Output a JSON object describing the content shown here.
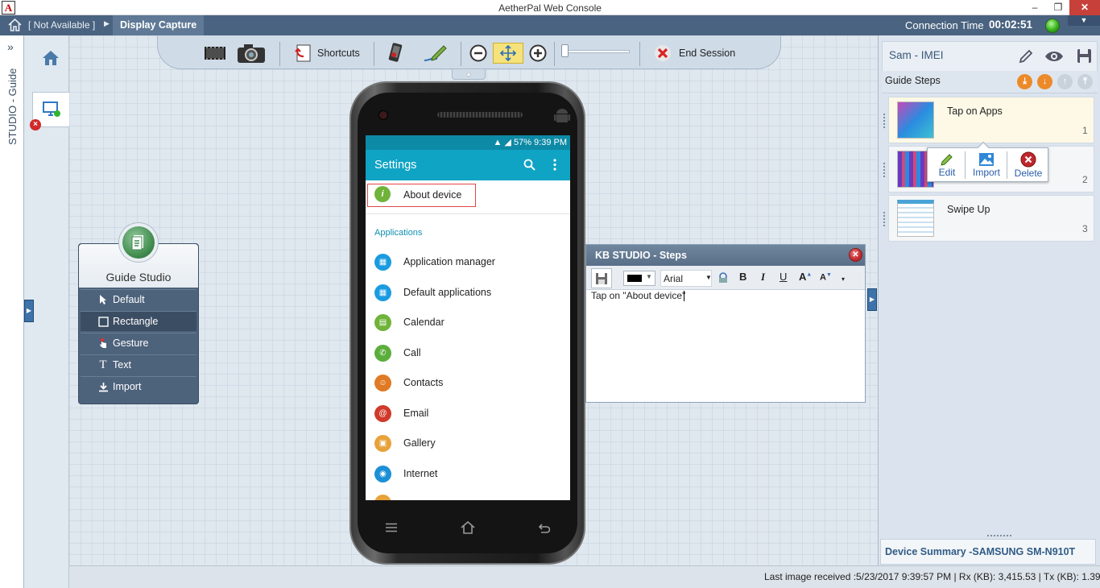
{
  "window": {
    "title": "AetherPal Web Console",
    "icon_label": "A",
    "minimize": "‒",
    "restore": "❐",
    "close": "✕"
  },
  "nav": {
    "home_icon": "home-icon",
    "breadcrumb_1": "[ Not Available ]",
    "breadcrumb_sep": "▶",
    "breadcrumb_2": "Display Capture",
    "connection_label": "Connection Time",
    "connection_time": "00:02:51",
    "collapse": "▼"
  },
  "side_tab": {
    "label": "STUDIO - Guide",
    "expand": "»"
  },
  "toolbar": {
    "shortcuts_label": "Shortcuts",
    "end_session_label": "End Session"
  },
  "guide_studio": {
    "title": "Guide Studio",
    "items": [
      {
        "label": "Default",
        "icon": "cursor-icon"
      },
      {
        "label": "Rectangle",
        "icon": "rectangle-icon"
      },
      {
        "label": "Gesture",
        "icon": "gesture-icon"
      },
      {
        "label": "Text",
        "icon": "text-icon"
      },
      {
        "label": "Import",
        "icon": "import-icon"
      }
    ]
  },
  "phone": {
    "status_text": "57% 9:39 PM",
    "app_title": "Settings",
    "about_label": "About device",
    "section": "Applications",
    "rows": [
      {
        "label": "Application manager",
        "color": "#1a9be0"
      },
      {
        "label": "Default applications",
        "color": "#1a9be0"
      },
      {
        "label": "Calendar",
        "color": "#6fb33a"
      },
      {
        "label": "Call",
        "color": "#5cae3c"
      },
      {
        "label": "Contacts",
        "color": "#e07a24"
      },
      {
        "label": "Email",
        "color": "#d03a2a"
      },
      {
        "label": "Gallery",
        "color": "#e8a23a"
      },
      {
        "label": "Internet",
        "color": "#1c8fd6"
      }
    ]
  },
  "kb_studio": {
    "title": "KB STUDIO - Steps",
    "font": "Arial",
    "bold": "B",
    "italic": "I",
    "underline": "U",
    "grow": "A",
    "shrink": "A",
    "text": "Tap on \"About device\""
  },
  "right_panel": {
    "user": "Sam - IMEI",
    "steps_label": "Guide Steps",
    "steps": [
      {
        "title": "Tap on Apps",
        "num": "1"
      },
      {
        "title": "",
        "num": "2"
      },
      {
        "title": "Swipe Up",
        "num": "3"
      }
    ],
    "popup": {
      "edit": "Edit",
      "import": "Import",
      "delete": "Delete"
    },
    "device_summary": "Device Summary -SAMSUNG SM-N910T"
  },
  "footer": {
    "text": "Last image received :5/23/2017 9:39:57 PM  |  Rx (KB): 3,415.53  |  Tx (KB): 1.39"
  }
}
